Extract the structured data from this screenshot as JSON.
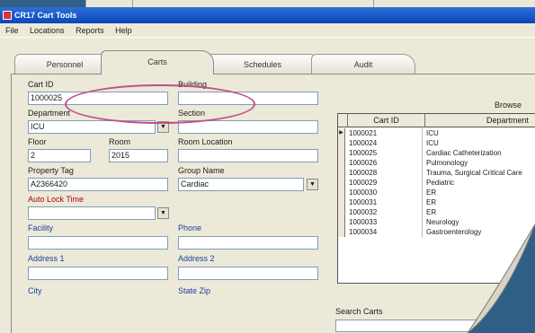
{
  "window": {
    "title": "CR17 Cart Tools"
  },
  "menu": [
    "File",
    "Locations",
    "Reports",
    "Help"
  ],
  "tabs": [
    "Personnel",
    "Carts",
    "Schedules",
    "Audit"
  ],
  "active_tab": "Carts",
  "form": {
    "cart_id": {
      "label": "Cart ID",
      "value": "1000025"
    },
    "building": {
      "label": "Building",
      "value": ""
    },
    "department": {
      "label": "Department",
      "value": "ICU"
    },
    "section": {
      "label": "Section",
      "value": ""
    },
    "floor": {
      "label": "Floor",
      "value": "2"
    },
    "room": {
      "label": "Room",
      "value": "2015"
    },
    "room_location": {
      "label": "Room Location",
      "value": ""
    },
    "property_tag": {
      "label": "Property Tag",
      "value": "A2366420"
    },
    "group_name": {
      "label": "Group Name",
      "value": "Cardiac"
    },
    "auto_lock_time": {
      "label": "Auto Lock Time",
      "value": ""
    },
    "facility": {
      "label": "Facility",
      "value": ""
    },
    "phone": {
      "label": "Phone",
      "value": ""
    },
    "address1": {
      "label": "Address 1",
      "value": ""
    },
    "address2": {
      "label": "Address 2",
      "value": ""
    },
    "city": {
      "label": "City",
      "value": ""
    },
    "state_zip": {
      "label": "State Zip",
      "value": ""
    }
  },
  "browse": {
    "title": "Browse",
    "columns": [
      "Cart ID",
      "Department"
    ],
    "rows": [
      {
        "cart_id": "1000021",
        "dept": "ICU"
      },
      {
        "cart_id": "1000024",
        "dept": "ICU"
      },
      {
        "cart_id": "1000025",
        "dept": "Cardiac Catheterization"
      },
      {
        "cart_id": "1000026",
        "dept": "Pulmonology"
      },
      {
        "cart_id": "1000028",
        "dept": "Trauma, Surgical Critical Care"
      },
      {
        "cart_id": "1000029",
        "dept": "Pediatric"
      },
      {
        "cart_id": "1000030",
        "dept": "ER"
      },
      {
        "cart_id": "1000031",
        "dept": "ER"
      },
      {
        "cart_id": "1000032",
        "dept": "ER"
      },
      {
        "cart_id": "1000033",
        "dept": "Neurology"
      },
      {
        "cart_id": "1000034",
        "dept": "Gastroenterology"
      }
    ],
    "search_label": "Search Carts",
    "search_value": ""
  },
  "colors": {
    "titlebar": "#0a46b8",
    "window_bg": "#ece9d8",
    "highlight_oval": "#c0508a",
    "desktop": "#2f5f86"
  },
  "icons": {
    "dropdown": "chevron-down-icon",
    "row_selector": "row-pointer-icon"
  }
}
